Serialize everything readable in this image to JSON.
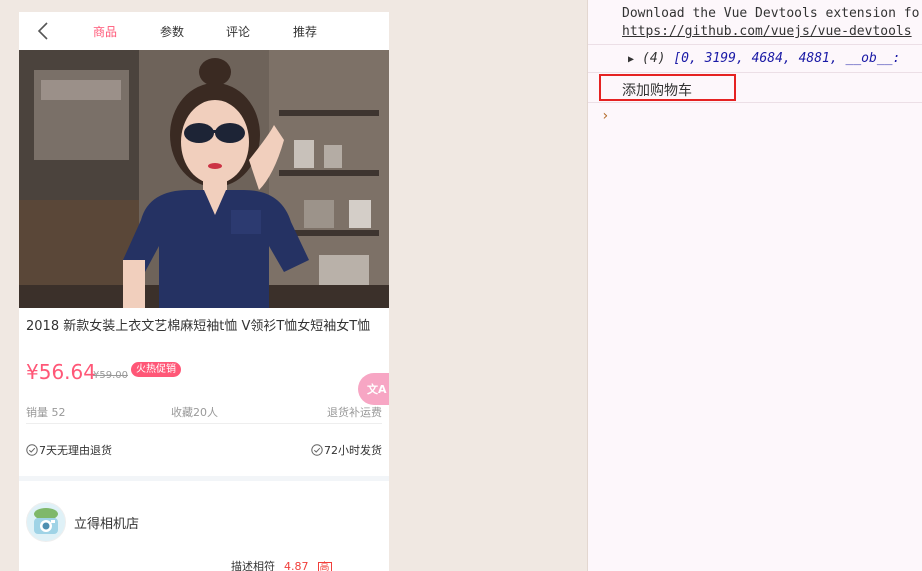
{
  "phone": {
    "nav": {
      "back_icon": "chevron-left-icon",
      "tabs": [
        {
          "label": "商品",
          "active": true
        },
        {
          "label": "参数",
          "active": false
        },
        {
          "label": "评论",
          "active": false
        },
        {
          "label": "推荐",
          "active": false
        }
      ]
    },
    "banner": {
      "slide_count": 14,
      "active_index": 3
    },
    "product": {
      "title": "2018 新款女装上衣文艺棉麻短袖t恤 V领衫T恤女短袖女T恤",
      "price": "¥56.64",
      "old_price": "¥59.00",
      "promo_badge": "火热促销"
    },
    "stats": {
      "sales": "销量 52",
      "favorites": "收藏20人",
      "return_policy": "退货补运费"
    },
    "services": [
      {
        "label": "7天无理由退货",
        "icon": "check-circle-icon"
      },
      {
        "label": "72小时发货",
        "icon": "check-circle-icon"
      }
    ],
    "shop": {
      "name": "立得相机店",
      "logo_icon": "camera-logo-icon",
      "score_label": "描述相符",
      "score_value": "4.87",
      "score_tag": "高"
    },
    "translate_icon": "translate-icon",
    "accent_color": "#ff5777"
  },
  "console": {
    "devtools_message": "Download the Vue Devtools extension fo",
    "devtools_link": "https://github.com/vuejs/vue-devtools",
    "array_prefix": "(4)",
    "array_values": "[0, 3199, 4684, 4881, __ob__: ",
    "log_message": "添加购物车",
    "prompt_symbol": "›"
  }
}
